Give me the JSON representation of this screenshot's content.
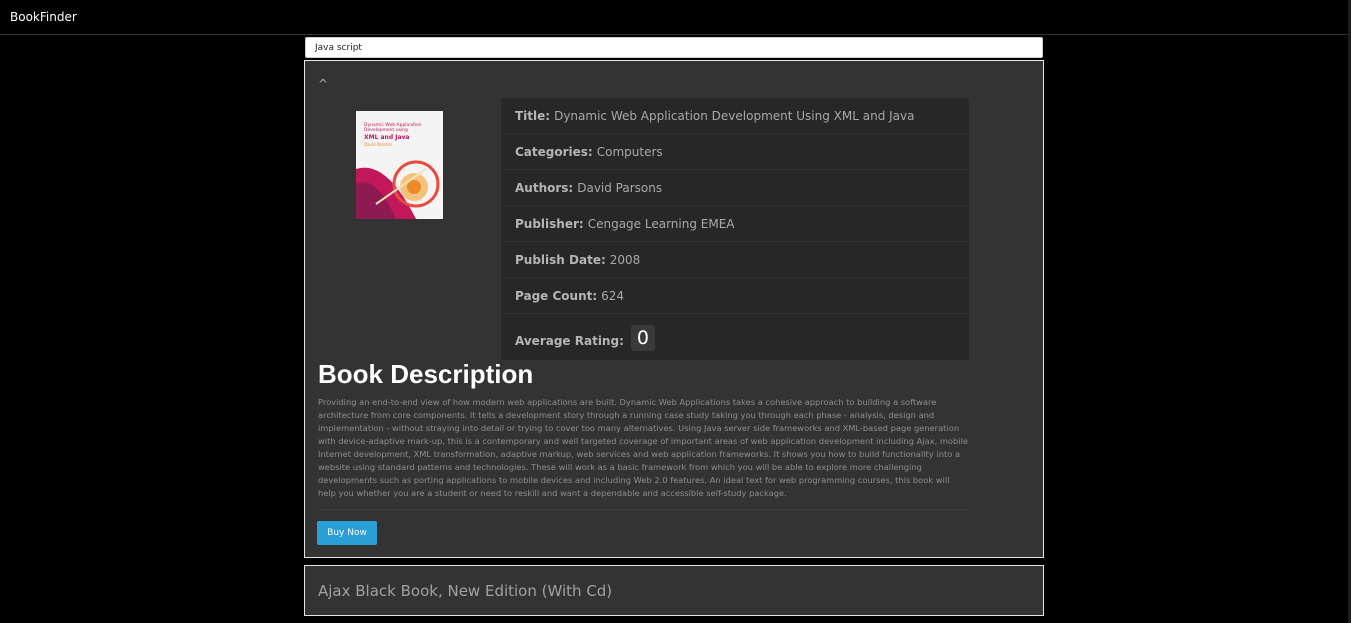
{
  "app": {
    "brand": "BookFinder"
  },
  "search": {
    "value": "Java script"
  },
  "expanded_book": {
    "toggle_icon": "^",
    "cover": {
      "line1": "Dynamic Web Application Development using",
      "line2": "XML and Java",
      "line3": "David Parsons"
    },
    "details": [
      {
        "key": "Title:",
        "value": "Dynamic Web Application Development Using XML and Java"
      },
      {
        "key": "Categories:",
        "value": "Computers"
      },
      {
        "key": "Authors:",
        "value": "David Parsons"
      },
      {
        "key": "Publisher:",
        "value": "Cengage Learning EMEA"
      },
      {
        "key": "Publish Date:",
        "value": "2008"
      },
      {
        "key": "Page Count:",
        "value": "624"
      },
      {
        "key": "Average Rating:",
        "value": "0"
      }
    ],
    "description_heading": "Book Description",
    "description": "Providing an end-to-end view of how modern web applications are built. Dynamic Web Applications takes a cohesive approach to building a software architecture from core components. It tells a development story through a running case study taking you through each phase - analysis, design and implementation - without straying into detail or trying to cover too many alternatives. Using Java server side frameworks and XML-based page generation with device-adaptive mark-up, this is a contemporary and well targeted coverage of important areas of web application development including Ajax, mobile Internet development, XML transformation, adaptive markup, web services and web application frameworks. It shows you how to build functionality into a website using standard patterns and technologies. These will work as a basic framework from which you will be able to explore more challenging developments such as porting applications to mobile devices and including Web 2.0 features. An ideal text for web programming courses, this book will help you whether you are a student or need to reskill and want a dependable and accessible self-study package.",
    "buy_label": "Buy Now"
  },
  "collapsed_book": {
    "title": "Ajax Black Book, New Edition (With Cd)"
  },
  "colors": {
    "accent": "#2a9fd6",
    "card_bg": "#333333",
    "page_bg": "#000000"
  }
}
